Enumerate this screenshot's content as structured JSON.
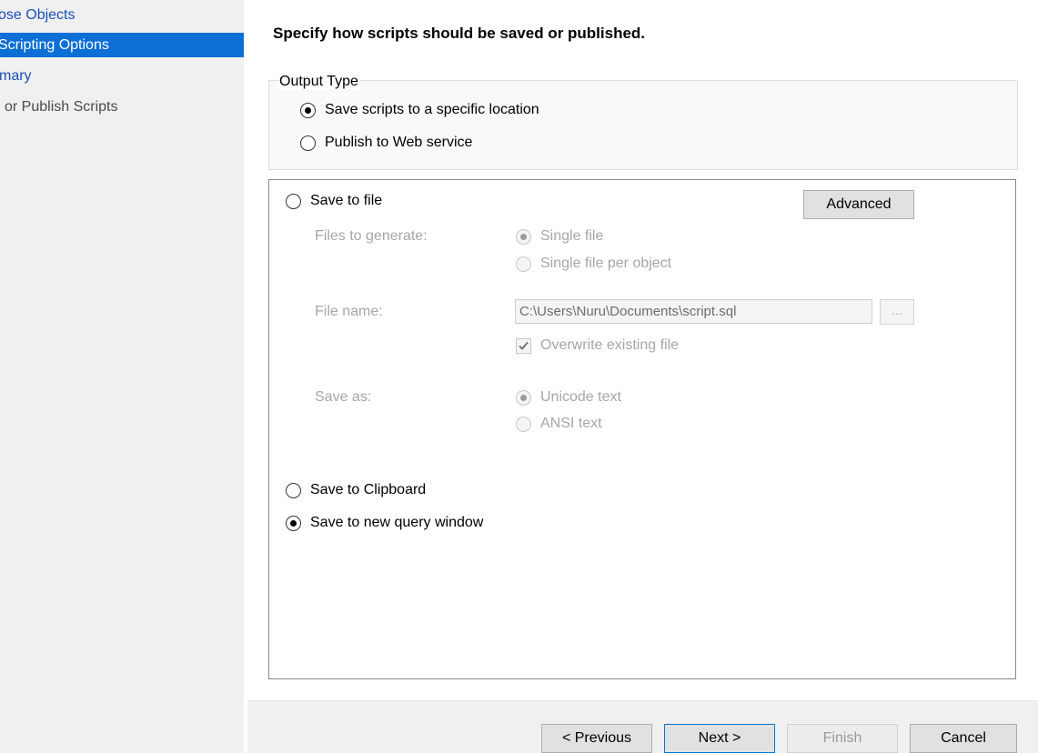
{
  "sidebar": {
    "items": [
      {
        "label": "ose Objects",
        "state": "link"
      },
      {
        "label": "Scripting Options",
        "state": "selected"
      },
      {
        "label": "mary",
        "state": "link"
      },
      {
        "label": "or Publish Scripts",
        "state": "disabled"
      }
    ]
  },
  "main": {
    "title": "Specify how scripts should be saved or published.",
    "output_type": {
      "legend": "Output Type",
      "options": [
        {
          "label": "Save scripts to a specific location",
          "checked": true
        },
        {
          "label": "Publish to Web service",
          "checked": false
        }
      ]
    },
    "save_to_file": {
      "label": "Save to file",
      "advanced_button": "Advanced",
      "files_to_generate": {
        "label": "Files to generate:",
        "options": [
          {
            "label": "Single file",
            "checked": true
          },
          {
            "label": "Single file per object",
            "checked": false
          }
        ]
      },
      "file_name": {
        "label": "File name:",
        "value": "C:\\Users\\Nuru\\Documents\\script.sql",
        "browse_label": "..."
      },
      "overwrite": {
        "label": "Overwrite existing file",
        "checked": true
      },
      "save_as": {
        "label": "Save as:",
        "options": [
          {
            "label": "Unicode text",
            "checked": true
          },
          {
            "label": "ANSI text",
            "checked": false
          }
        ]
      }
    },
    "save_to_clipboard": {
      "label": "Save to Clipboard",
      "checked": false
    },
    "save_to_query_window": {
      "label": "Save to new query window",
      "checked": true
    }
  },
  "footer": {
    "previous": "< Previous",
    "next": "Next >",
    "finish": "Finish",
    "cancel": "Cancel"
  },
  "colors": {
    "selection": "#0b6fd6",
    "link": "#1a50b8",
    "disabled_text": "#a6a6a6"
  }
}
